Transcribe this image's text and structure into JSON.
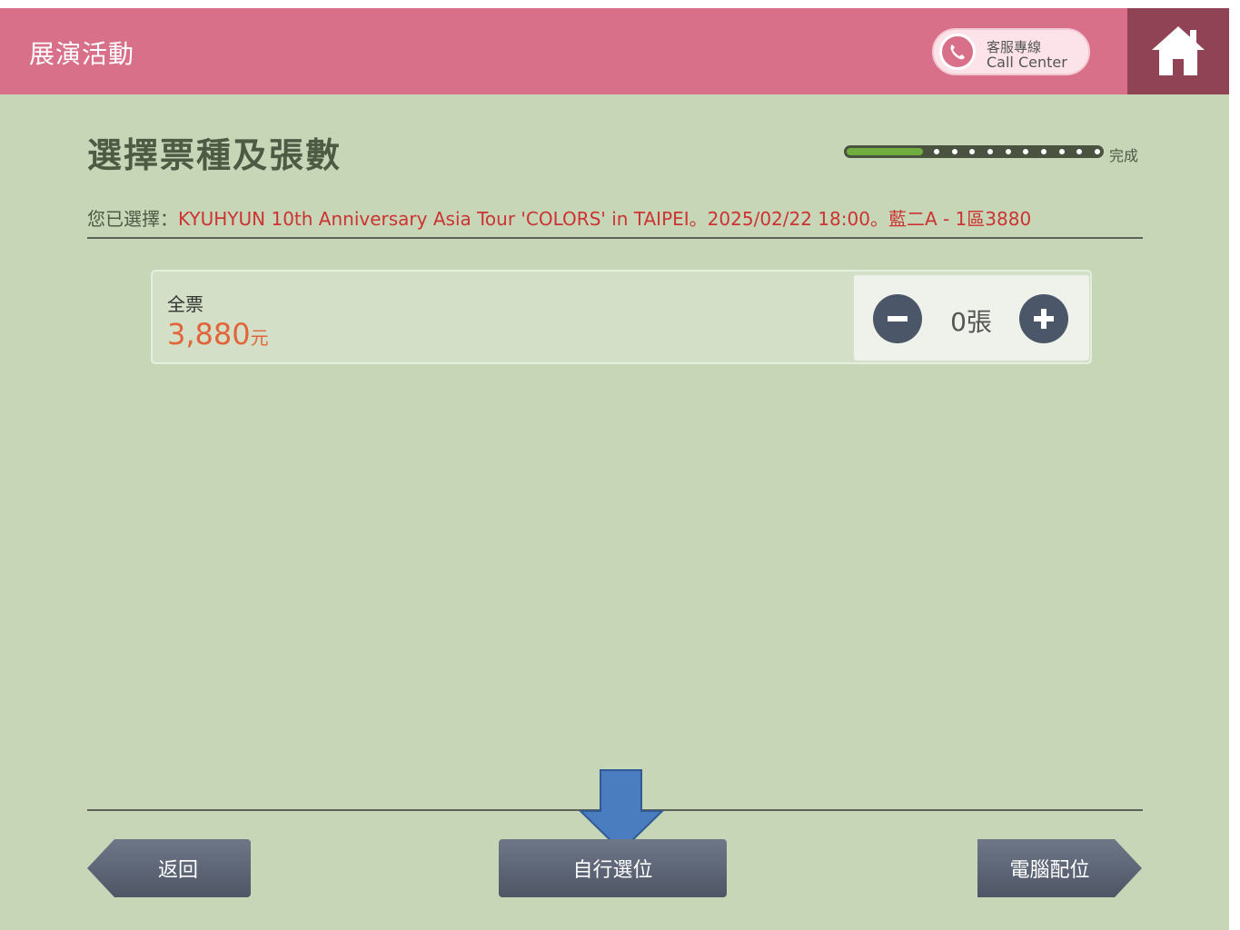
{
  "header": {
    "title": "展演活動",
    "call_center_line1": "客服專線",
    "call_center_line2": "Call Center",
    "home_icon": "home-icon",
    "colors": {
      "header_bg": "#d8708a",
      "home_bg": "#8f4355"
    }
  },
  "page": {
    "title": "選擇票種及張數",
    "progress": {
      "fraction": 0.3,
      "label": "完成"
    },
    "selection_prefix": "您已選擇：",
    "selection_detail": "KYUHYUN 10th Anniversary Asia Tour 'COLORS' in TAIPEI。2025/02/22 18:00。藍二A - 1區3880"
  },
  "ticket": {
    "name": "全票",
    "price": "3,880",
    "price_unit": "元",
    "quantity": "0張"
  },
  "buttons": {
    "back": "返回",
    "self_select": "自行選位",
    "auto_assign": "電腦配位"
  }
}
